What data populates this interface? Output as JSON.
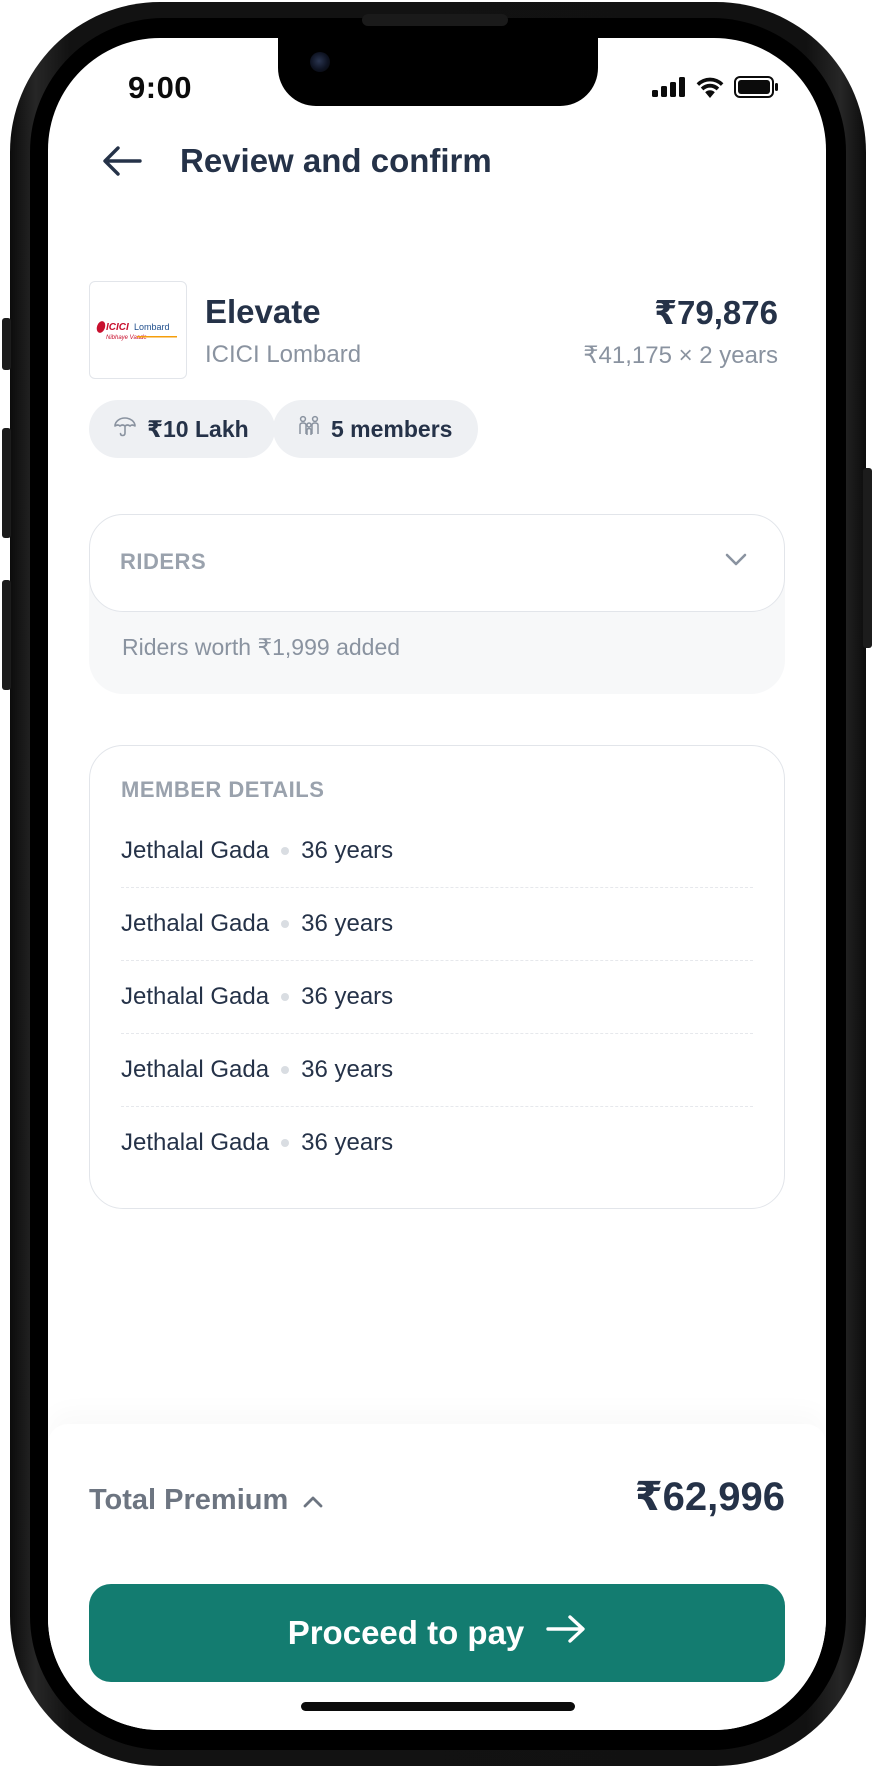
{
  "status_bar": {
    "time": "9:00"
  },
  "header": {
    "back_icon": "arrow-left-icon",
    "title": "Review and confirm"
  },
  "plan": {
    "logo_text": "ICICI Lombard",
    "logo_tagline": "Nibhaye Vaade",
    "name": "Elevate",
    "insurer": "ICICI Lombard",
    "price": "₹79,876",
    "price_breakdown": "₹41,175 × 2 years"
  },
  "chips": [
    {
      "icon": "umbrella-icon",
      "label": "₹10 Lakh"
    },
    {
      "icon": "family-icon",
      "label": "5 members"
    }
  ],
  "riders": {
    "title": "RIDERS",
    "summary": "Riders worth ₹1,999 added",
    "expanded": false
  },
  "members": {
    "title": "MEMBER DETAILS",
    "list": [
      {
        "name": "Jethalal Gada",
        "age": "36 years"
      },
      {
        "name": "Jethalal Gada",
        "age": "36 years"
      },
      {
        "name": "Jethalal Gada",
        "age": "36 years"
      },
      {
        "name": "Jethalal Gada",
        "age": "36 years"
      },
      {
        "name": "Jethalal Gada",
        "age": "36 years"
      }
    ]
  },
  "footer": {
    "total_label": "Total Premium",
    "total_value": "₹62,996",
    "cta_label": "Proceed to pay"
  },
  "colors": {
    "primary": "#137c70",
    "text_dark": "#253248",
    "text_muted": "#8a93a0"
  }
}
